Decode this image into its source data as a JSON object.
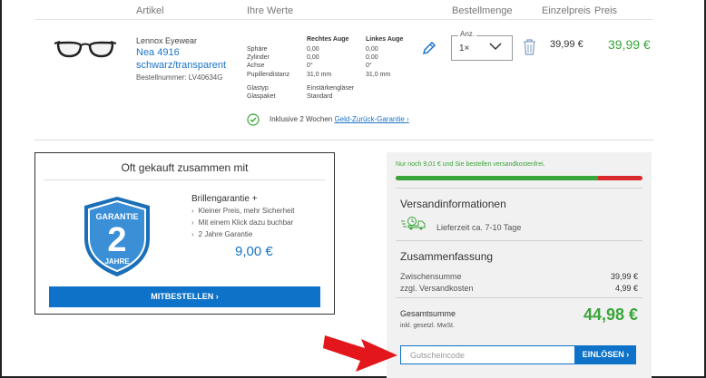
{
  "table_header": {
    "article": "Artikel",
    "values": "Ihre Werte",
    "quantity": "Bestellmenge",
    "unit_price": "Einzelpreis",
    "price": "Preis"
  },
  "product": {
    "brand": "Lennox Eyewear",
    "model": "Nea 4916",
    "color": "schwarz/transparent",
    "article_no": "Bestellnummer: LV40634G"
  },
  "prescription": {
    "right_header": "Rechtes Auge",
    "left_header": "Linkes Auge",
    "rows": [
      {
        "label": "Sphäre",
        "right": "0,00",
        "left": "0,00"
      },
      {
        "label": "Zylinder",
        "right": "0,00",
        "left": "0,00"
      },
      {
        "label": "Achse",
        "right": "0°",
        "left": "0°"
      },
      {
        "label": "Pupillendistanz",
        "right": "31,0 mm",
        "left": "31,0 mm"
      }
    ],
    "lens_type_label": "Glastyp",
    "lens_type_value": "Einstärkengläser",
    "lens_pack_label": "Glaspaket",
    "lens_pack_value": "Standard"
  },
  "quantity": {
    "legend": "Anz.",
    "value": "1×"
  },
  "unit_price": "39,99 €",
  "line_price": "39,99 €",
  "guarantee": {
    "text": "Inklusive 2 Wochen ",
    "link": "Geld-Zurück-Garantie ›"
  },
  "offer": {
    "title": "Oft gekauft zusammen mit",
    "shield_top": "GARANTIE",
    "shield_number": "2",
    "shield_bottom": "JAHRE",
    "product_name": "Brillengarantie +",
    "features": [
      "Kleiner Preis, mehr Sicherheit",
      "Mit einem Klick dazu buchbar",
      "2 Jahre Garantie"
    ],
    "price": "9,00 €",
    "button": "MITBESTELLEN ›"
  },
  "summary": {
    "free_shipping_text": "Nur noch 9,01 € und Sie bestellen versandkostenfrei.",
    "free_shipping_progress": 0.82,
    "shipping_title": "Versandinformationen",
    "delivery": "Lieferzeit ca. 7-10 Tage",
    "summary_title": "Zusammenfassung",
    "subtotal_label": "Zwischensumme",
    "subtotal_value": "39,99 €",
    "shipping_label": "zzgl. Versandkosten",
    "shipping_value": "4,99 €",
    "total_label": "Gesamtsumme",
    "total_note": "inkl. gesetzl. MwSt.",
    "total_value": "44,98 €",
    "coupon_placeholder": "Gutscheincode",
    "redeem_button": "EINLÖSEN ›"
  },
  "colors": {
    "accent_blue": "#0d72c8",
    "price_green": "#3aa53a",
    "arrow_red": "#e3161b"
  }
}
